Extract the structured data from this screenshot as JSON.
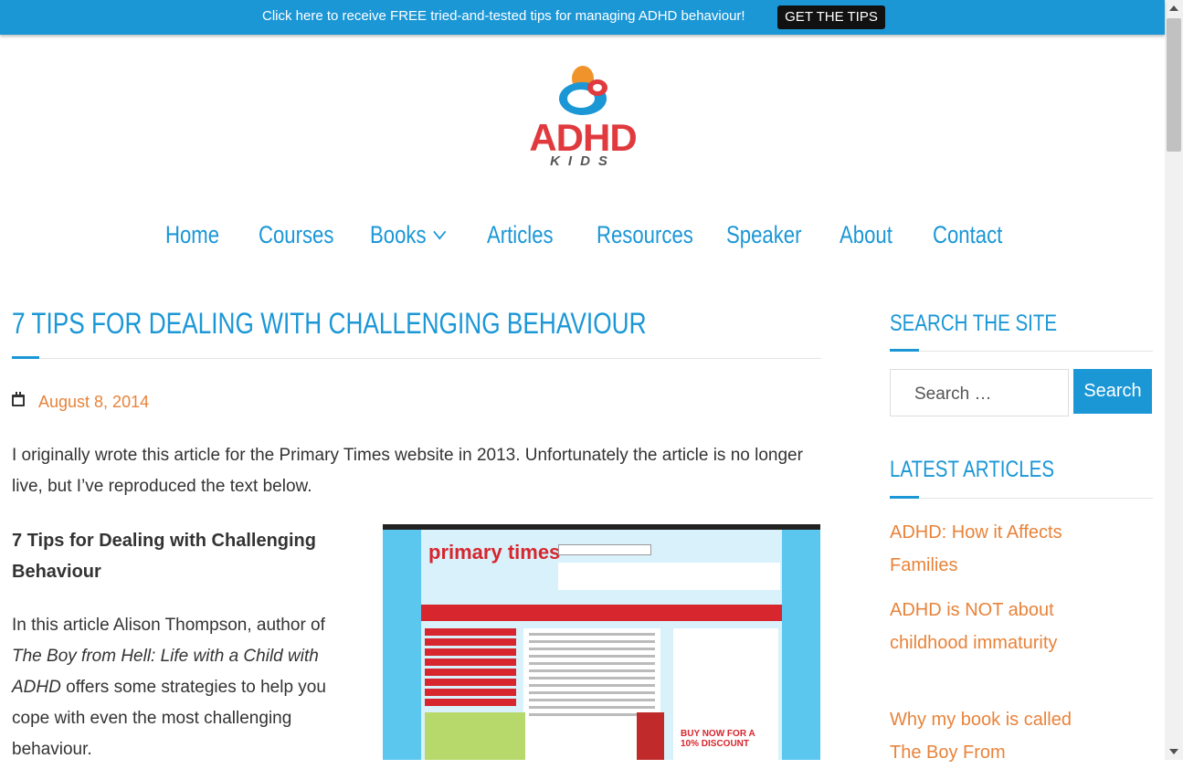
{
  "topbar": {
    "text": "Click here to receive FREE tried-and-tested tips for managing ADHD behaviour!",
    "button_label": "GET THE TIPS"
  },
  "logo": {
    "main": "ADHD",
    "sub": "KIDS"
  },
  "nav": {
    "items": [
      {
        "label": "Home"
      },
      {
        "label": "Courses"
      },
      {
        "label": "Books",
        "has_dropdown": true
      },
      {
        "label": "Articles"
      },
      {
        "label": "Resources"
      },
      {
        "label": "Speaker"
      },
      {
        "label": "About"
      },
      {
        "label": "Contact"
      }
    ]
  },
  "post": {
    "title": "7 TIPS FOR DEALING WITH CHALLENGING BEHAVIOUR",
    "date": "August 8, 2014",
    "intro": "I originally wrote this article for the Primary Times website in 2013. Unfortunately the article is no longer live, but I’ve reproduced the text below.",
    "subheading": "7 Tips for Dealing with Challenging Behaviour",
    "para_before": "In this article Alison Thompson, author of ",
    "para_book": "The Boy from Hell: Life with a Child with ADHD",
    "para_after": " offers some strategies to help you cope with even the most challenging behaviour.",
    "image_logo": "primary times",
    "image_buy": "BUY NOW FOR A 10% DISCOUNT"
  },
  "sidebar": {
    "search_title": "SEARCH THE SITE",
    "search_placeholder": "Search …",
    "search_button": "Search",
    "latest_title": "LATEST ARTICLES",
    "latest": [
      "ADHD: How it Affects Families",
      "ADHD is NOT about childhood immaturity",
      "Why my book is called The Boy From"
    ]
  },
  "colors": {
    "brand_blue": "#1b97d6",
    "accent_orange": "#e8833a",
    "logo_red": "#e03a3e"
  }
}
